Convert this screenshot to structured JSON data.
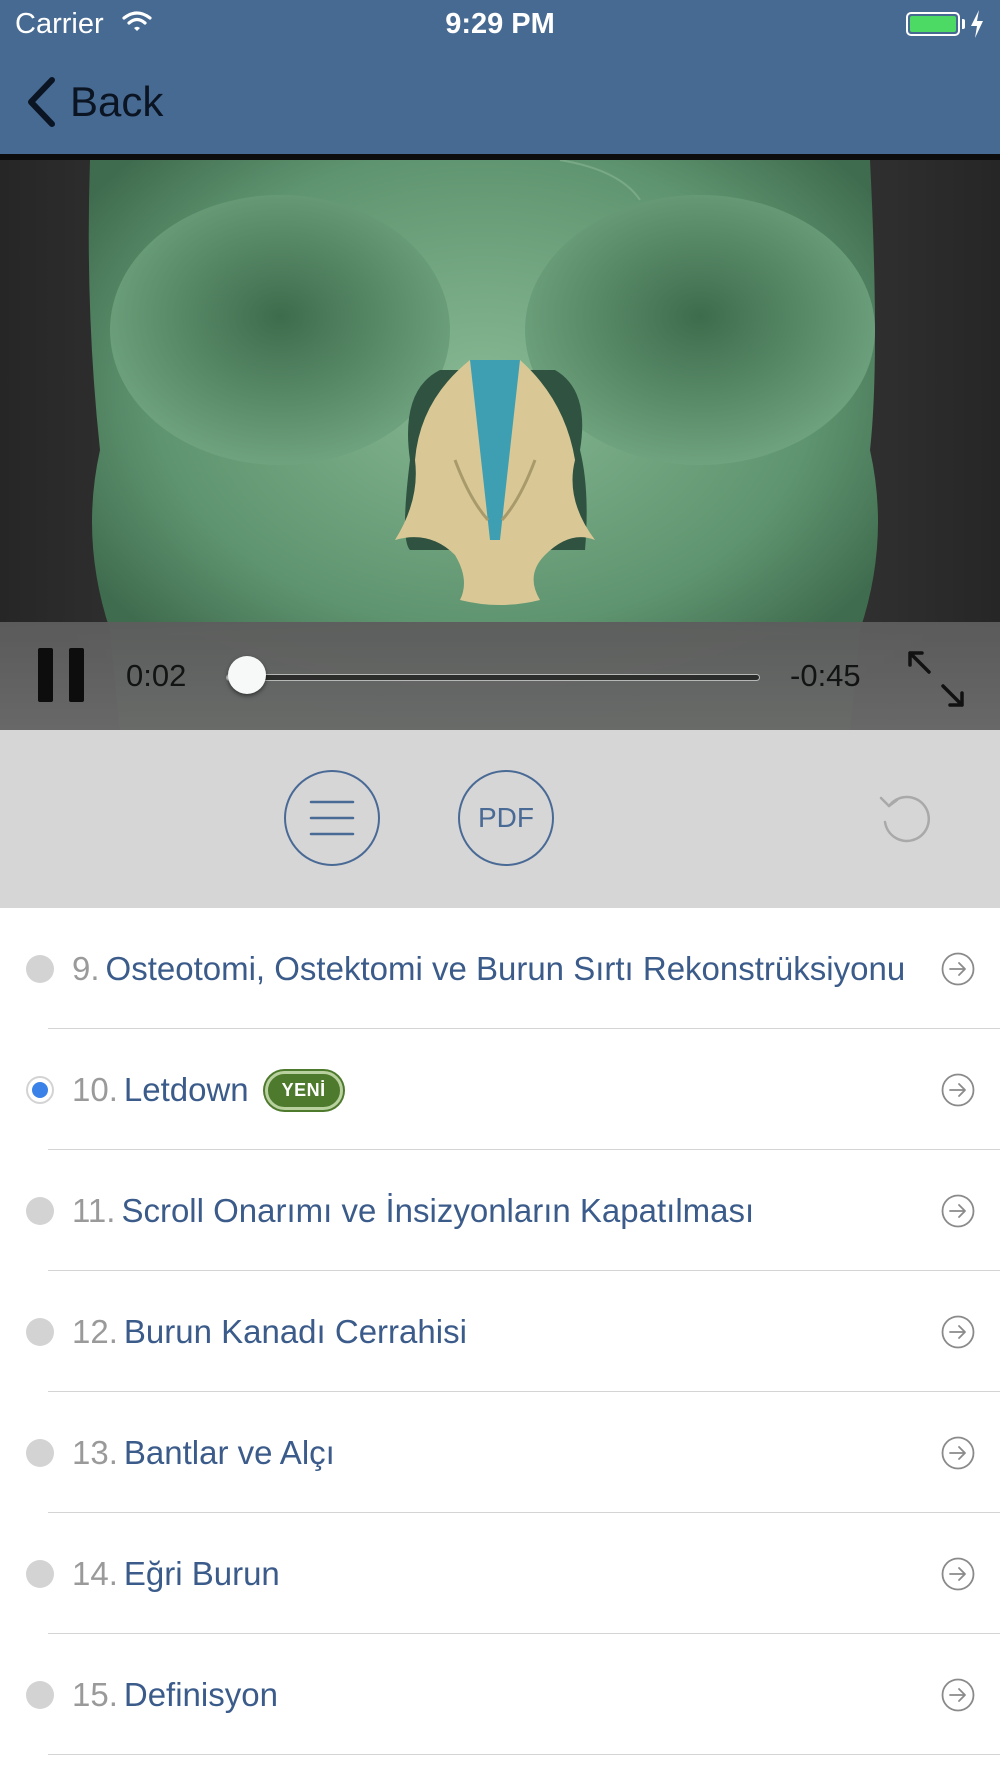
{
  "status_bar": {
    "carrier": "Carrier",
    "time": "9:29 PM"
  },
  "nav": {
    "back_label": "Back"
  },
  "player": {
    "elapsed": "0:02",
    "remaining": "-0:45",
    "progress": 0.04
  },
  "toolbar": {
    "pdf_label": "PDF"
  },
  "lessons": [
    {
      "number": "9.",
      "title": "Osteotomi, Ostektomi ve Burun Sırtı Rekonstrüksiyonu",
      "active": false,
      "badge": ""
    },
    {
      "number": "10.",
      "title": "Letdown",
      "active": true,
      "badge": "YENİ"
    },
    {
      "number": "11.",
      "title": "Scroll Onarımı ve İnsizyonların Kapatılması",
      "active": false,
      "badge": ""
    },
    {
      "number": "12.",
      "title": "Burun Kanadı Cerrahisi",
      "active": false,
      "badge": ""
    },
    {
      "number": "13.",
      "title": "Bantlar ve Alçı",
      "active": false,
      "badge": ""
    },
    {
      "number": "14.",
      "title": "Eğri Burun",
      "active": false,
      "badge": ""
    },
    {
      "number": "15.",
      "title": "Definisyon",
      "active": false,
      "badge": ""
    }
  ],
  "colors": {
    "header": "#476a93",
    "accent": "#3b5b8a",
    "active_dot": "#3b82e8",
    "badge": "#4d7a2d"
  }
}
